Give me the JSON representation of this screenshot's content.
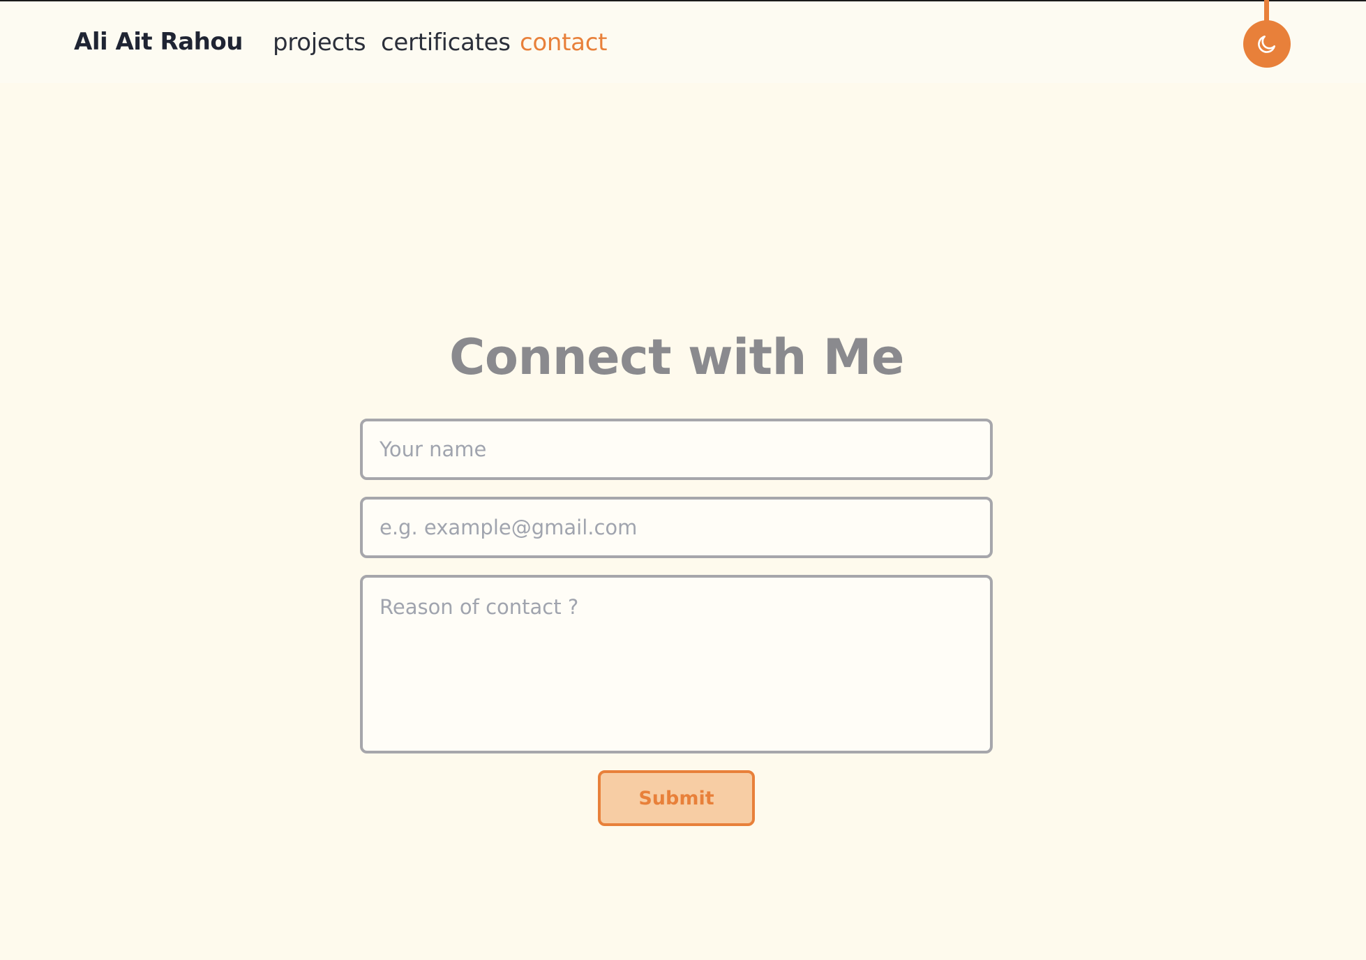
{
  "header": {
    "brand": "Ali Ait Rahou",
    "nav": [
      {
        "label": "projects",
        "active": false
      },
      {
        "label": "certificates",
        "active": false
      },
      {
        "label": "contact",
        "active": true
      }
    ],
    "theme_toggle_icon": "moon-icon"
  },
  "contact": {
    "title": "Connect with Me",
    "name_placeholder": "Your name",
    "email_placeholder": "e.g. example@gmail.com",
    "reason_placeholder": "Reason of contact ?",
    "submit_label": "Submit"
  },
  "colors": {
    "accent": "#e8803a",
    "background": "#fefaed",
    "heading": "#8a8a8e",
    "input_border": "#a6a6ab",
    "button_fill": "#f7cda4"
  }
}
